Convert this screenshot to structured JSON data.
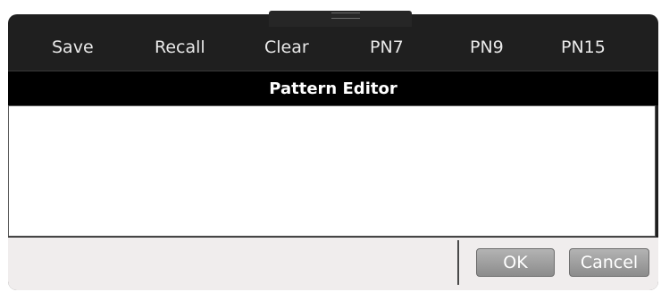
{
  "toolbar": {
    "items": [
      {
        "label": "Save"
      },
      {
        "label": "Recall"
      },
      {
        "label": "Clear"
      },
      {
        "label": "PN7"
      },
      {
        "label": "PN9"
      },
      {
        "label": "PN15"
      }
    ]
  },
  "title_bar": {
    "title": "Pattern Editor"
  },
  "editor": {
    "content": ""
  },
  "footer": {
    "ok_label": "OK",
    "cancel_label": "Cancel"
  },
  "colors": {
    "window_bg": "#1f1f1f",
    "title_bg": "#000000",
    "editor_bg": "#ffffff",
    "footer_bg": "#f0eded",
    "button_bg": "#a0a0a0"
  }
}
